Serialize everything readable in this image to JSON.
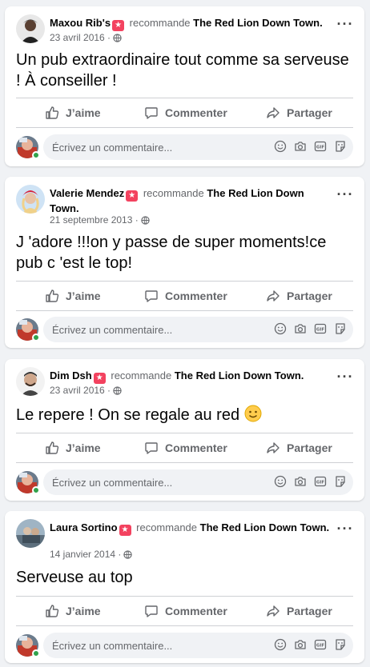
{
  "posts": [
    {
      "author": "Maxou Rib's",
      "verb": "recommande",
      "page": "The Red Lion Down Town.",
      "date": "23 avril 2016",
      "text": "Un pub extraordinaire tout comme sa serveuse ! À conseiller !"
    },
    {
      "author": "Valerie Mendez",
      "verb": "recommande",
      "page": "The Red Lion Down Town.",
      "date": "21 septembre 2013",
      "text": "J 'adore !!!on y passe de super moments!ce pub c 'est le top!"
    },
    {
      "author": "Dim Dsh",
      "verb": "recommande",
      "page": "The Red Lion Down Town.",
      "date": "23 avril 2016",
      "text": "Le repere ! On se regale au red"
    },
    {
      "author": "Laura Sortino",
      "verb": "recommande",
      "page": "The Red Lion Down Town.",
      "date": "14 janvier 2014",
      "text": "Serveuse au top"
    }
  ],
  "actions": {
    "like": "J’aime",
    "comment": "Commenter",
    "share": "Partager"
  },
  "comment_box": {
    "placeholder": "Écrivez un commentaire..."
  },
  "icons": {
    "more": "more-horizontal-icon",
    "globe": "globe-icon",
    "like": "thumbs-up-icon",
    "comment": "speech-bubble-icon",
    "share": "share-arrow-icon",
    "emoji": "smiley-icon",
    "camera": "camera-icon",
    "gif": "gif-icon",
    "sticker": "sticker-icon",
    "recommend": "recommend-star-badge"
  },
  "colors": {
    "background": "#f0f2f5",
    "card": "#ffffff",
    "secondary_text": "#65676b",
    "recommend_badge": "#f3425f",
    "online": "#31a24c"
  }
}
